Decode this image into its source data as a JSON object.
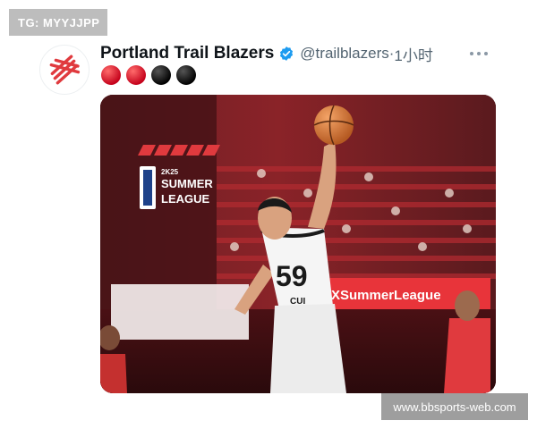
{
  "watermark": {
    "tg_label": "TG: MYYJJPP",
    "site_label": "www.bbsports-web.com"
  },
  "tweet": {
    "display_name": "Portland Trail Blazers",
    "handle": "@trailblazers",
    "separator": " · ",
    "time": "1小时",
    "verified": true,
    "icons": {
      "avatar": "blazers-pinwheel-logo",
      "verified": "verified-badge-icon",
      "more": "more-options-icon",
      "emoji": "basketball-emoji"
    },
    "emoji_colors": [
      "#e01e37",
      "#e01e37",
      "#111111",
      "#111111"
    ],
    "media": {
      "logo_year": "2K25",
      "logo_line1": "SUMMER",
      "logo_line2": "LEAGUE",
      "jersey_number": "59",
      "jersey_name": "CUI",
      "banner_text": "XSummerLeague"
    }
  },
  "colors": {
    "brand_red": "#e03a3e",
    "verified_blue": "#1d9bf0",
    "text_primary": "#0f1419",
    "text_secondary": "#536471"
  }
}
